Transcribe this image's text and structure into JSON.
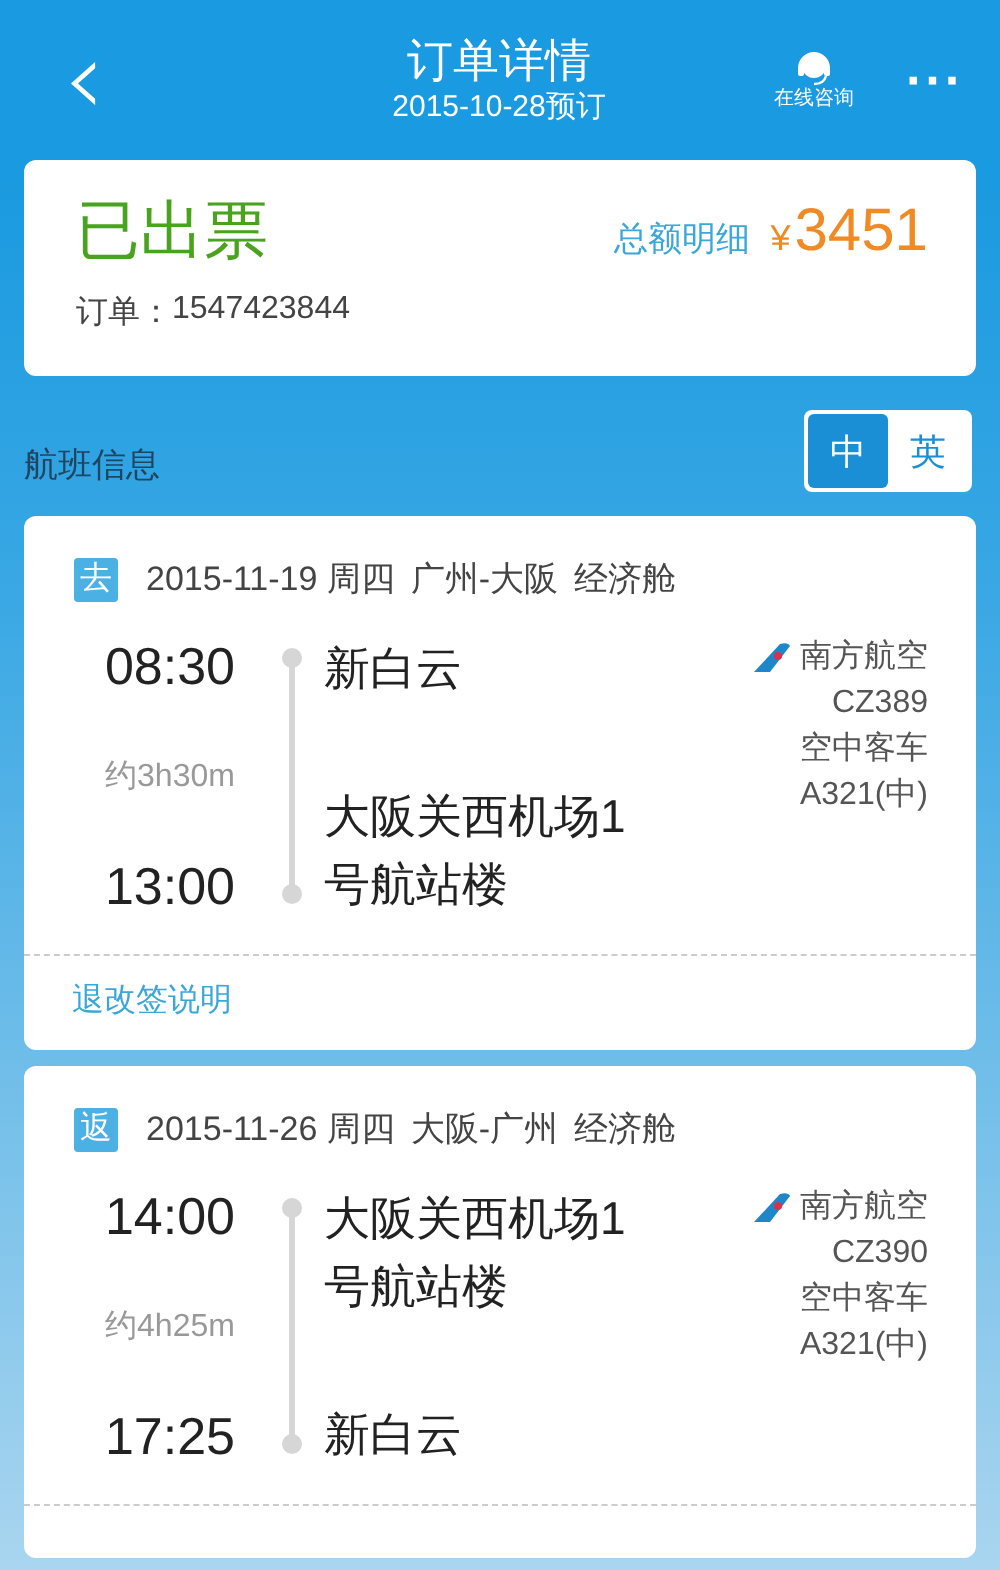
{
  "header": {
    "back_icon": "‹",
    "title": "订单详情",
    "subtitle": "2015-10-28预订",
    "service_label": "在线咨询",
    "more_icon": "···"
  },
  "status_card": {
    "status": "已出票",
    "order_label": "订单：",
    "order_no": "1547423844",
    "total_label": "总额明细",
    "currency": "¥",
    "amount": "3451"
  },
  "section_title": "航班信息",
  "lang_toggle": [
    {
      "label": "中",
      "selected": true
    },
    {
      "label": "英",
      "selected": false
    }
  ],
  "flights": [
    {
      "badge": "去",
      "date": "2015-11-19 周四",
      "route": "广州-大阪",
      "cabin": "经济舱",
      "dep_time": "08:30",
      "duration": "约3h30m",
      "arr_time": "13:00",
      "dep_airport": "新白云",
      "arr_airport": "大阪关西机场1号航站楼",
      "airline": "南方航空",
      "flight_no": "CZ389",
      "aircraft": "空中客车",
      "model": "A321(中)",
      "refund_link": "退改签说明"
    },
    {
      "badge": "返",
      "date": "2015-11-26 周四",
      "route": "大阪-广州",
      "cabin": "经济舱",
      "dep_time": "14:00",
      "duration": "约4h25m",
      "arr_time": "17:25",
      "dep_airport": "大阪关西机场1号航站楼",
      "arr_airport": "新白云",
      "airline": "南方航空",
      "flight_no": "CZ390",
      "aircraft": "空中客车",
      "model": "A321(中)"
    }
  ]
}
